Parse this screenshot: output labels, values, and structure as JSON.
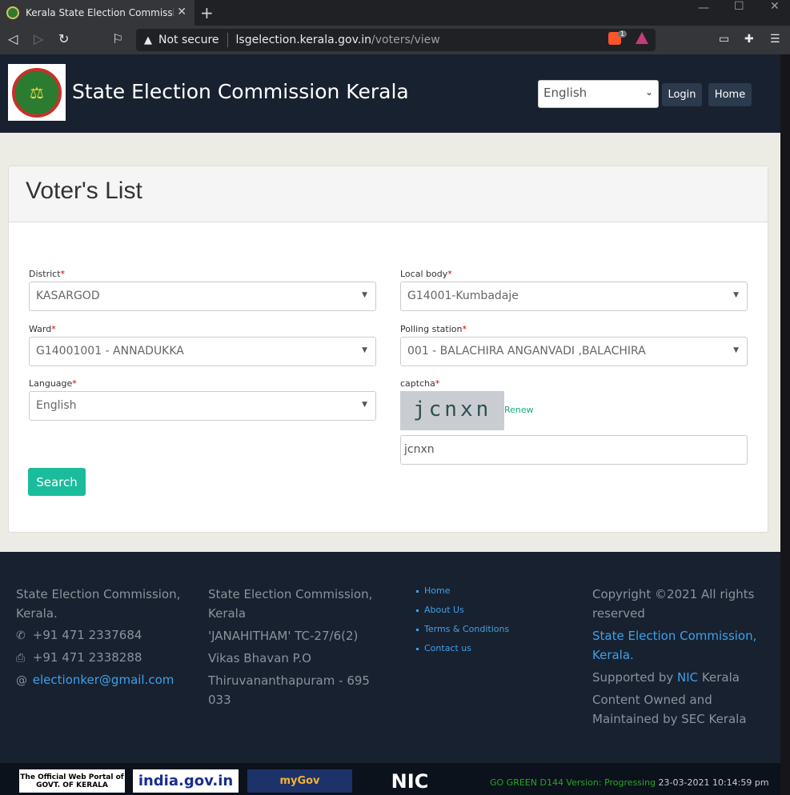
{
  "browser": {
    "tab_title": "Kerala State Election Commission",
    "security_label": "Not secure",
    "url_host": "lsgelection.kerala.gov.in",
    "url_path": "/voters/view",
    "brave_badge": "1"
  },
  "header": {
    "site_title": "State Election Commission Kerala",
    "language_selected": "English",
    "login_label": "Login",
    "home_label": "Home"
  },
  "form": {
    "card_title": "Voter's List",
    "district": {
      "label": "District",
      "value": "KASARGOD"
    },
    "local_body": {
      "label": "Local body",
      "value": "G14001-Kumbadaje"
    },
    "ward": {
      "label": "Ward",
      "value": "G14001001 - ANNADUKKA"
    },
    "polling_station": {
      "label": "Polling station",
      "value": "001 - BALACHIRA ANGANVADI ,BALACHIRA"
    },
    "language": {
      "label": "Language",
      "value": "English"
    },
    "captcha": {
      "label": "captcha",
      "image_text": "jcnxn",
      "renew_label": "Renew",
      "input_value": "jcnxn"
    },
    "required_mark": "*",
    "search_label": "Search"
  },
  "footer": {
    "col1": {
      "line1": "State Election Commission,",
      "line2": "Kerala.",
      "phone": "+91 471 2337684",
      "fax": "+91 471 2338288",
      "email": "electionker@gmail.com"
    },
    "col2": {
      "line1": "State Election Commission,",
      "line2": "Kerala",
      "line3": "'JANAHITHAM' TC-27/6(2)",
      "line4": "Vikas Bhavan P.O",
      "line5": "Thiruvananthapuram - 695",
      "line6": "033"
    },
    "links": [
      "Home",
      "About Us",
      "Terms & Conditions",
      "Contact us"
    ],
    "col4": {
      "copyright1": "Copyright ©2021 All rights",
      "copyright2": "reserved",
      "sec_link1": "State Election Commission,",
      "sec_link2": "Kerala.",
      "supported_prefix": "Supported by",
      "nic_link": "NIC",
      "supported_suffix": "Kerala",
      "owned1": "Content Owned and",
      "owned2": "Maintained by SEC Kerala"
    }
  },
  "bottom": {
    "kerala_logo_text": "The Official Web Portal of GOVT. OF KERALA",
    "india_logo_text": "india.gov.in",
    "mygov_logo_text": "myGov",
    "nic_logo_text": "NIC",
    "version_text": "GO GREEN D144 Version: Progressing",
    "timestamp": "23-03-2021 10:14:59 pm"
  },
  "colors": {
    "header_bg": "#18212f",
    "accent_button": "#1abc9c",
    "link": "#3fa1e8"
  }
}
